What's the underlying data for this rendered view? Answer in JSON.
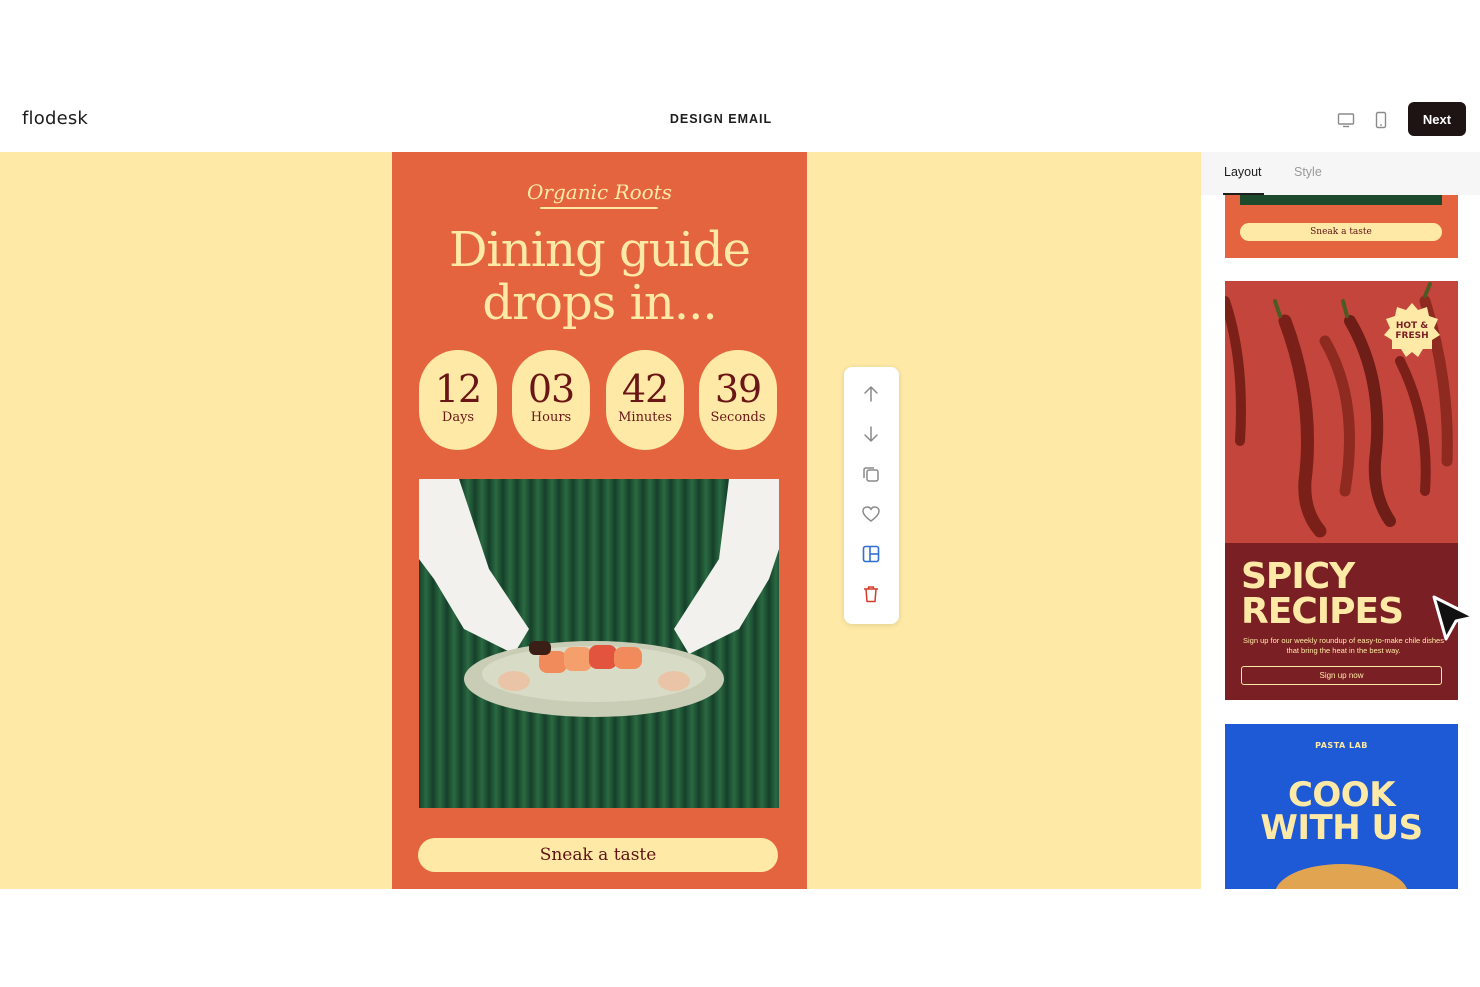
{
  "header": {
    "logo": "flodesk",
    "title": "DESIGN EMAIL",
    "next_label": "Next"
  },
  "email": {
    "brand": "Organic Roots",
    "headline_line1": "Dining guide",
    "headline_line2": "drops in...",
    "countdown": [
      {
        "value": "12",
        "unit": "Days"
      },
      {
        "value": "03",
        "unit": "Hours"
      },
      {
        "value": "42",
        "unit": "Minutes"
      },
      {
        "value": "39",
        "unit": "Seconds"
      }
    ],
    "cta_label": "Sneak a taste"
  },
  "toolbar": {
    "items": [
      "arrow-up-icon",
      "arrow-down-icon",
      "duplicate-icon",
      "heart-icon",
      "layout-icon",
      "trash-icon"
    ]
  },
  "panel": {
    "tabs": [
      {
        "label": "Layout",
        "active": true
      },
      {
        "label": "Style",
        "active": false
      }
    ],
    "templates": {
      "card1": {
        "button": "Sneak a taste"
      },
      "card2": {
        "badge": "HOT &\nFRESH",
        "title": "SPICY\nRECIPES",
        "description": "Sign up for our weekly roundup of easy-to-make chile dishes that bring the heat in the best way.",
        "button": "Sign up now"
      },
      "card3": {
        "brand": "PASTA LAB",
        "title": "COOK\nWITH US"
      }
    }
  },
  "colors": {
    "canvas_bg": "#feeaa6",
    "email_bg": "#e46440",
    "accent_cream": "#feeaa6",
    "dark_red": "#6b1616",
    "next_button": "#1e1414",
    "card2_bottom": "#7a1f24",
    "card3_bg": "#1e5ad6"
  }
}
